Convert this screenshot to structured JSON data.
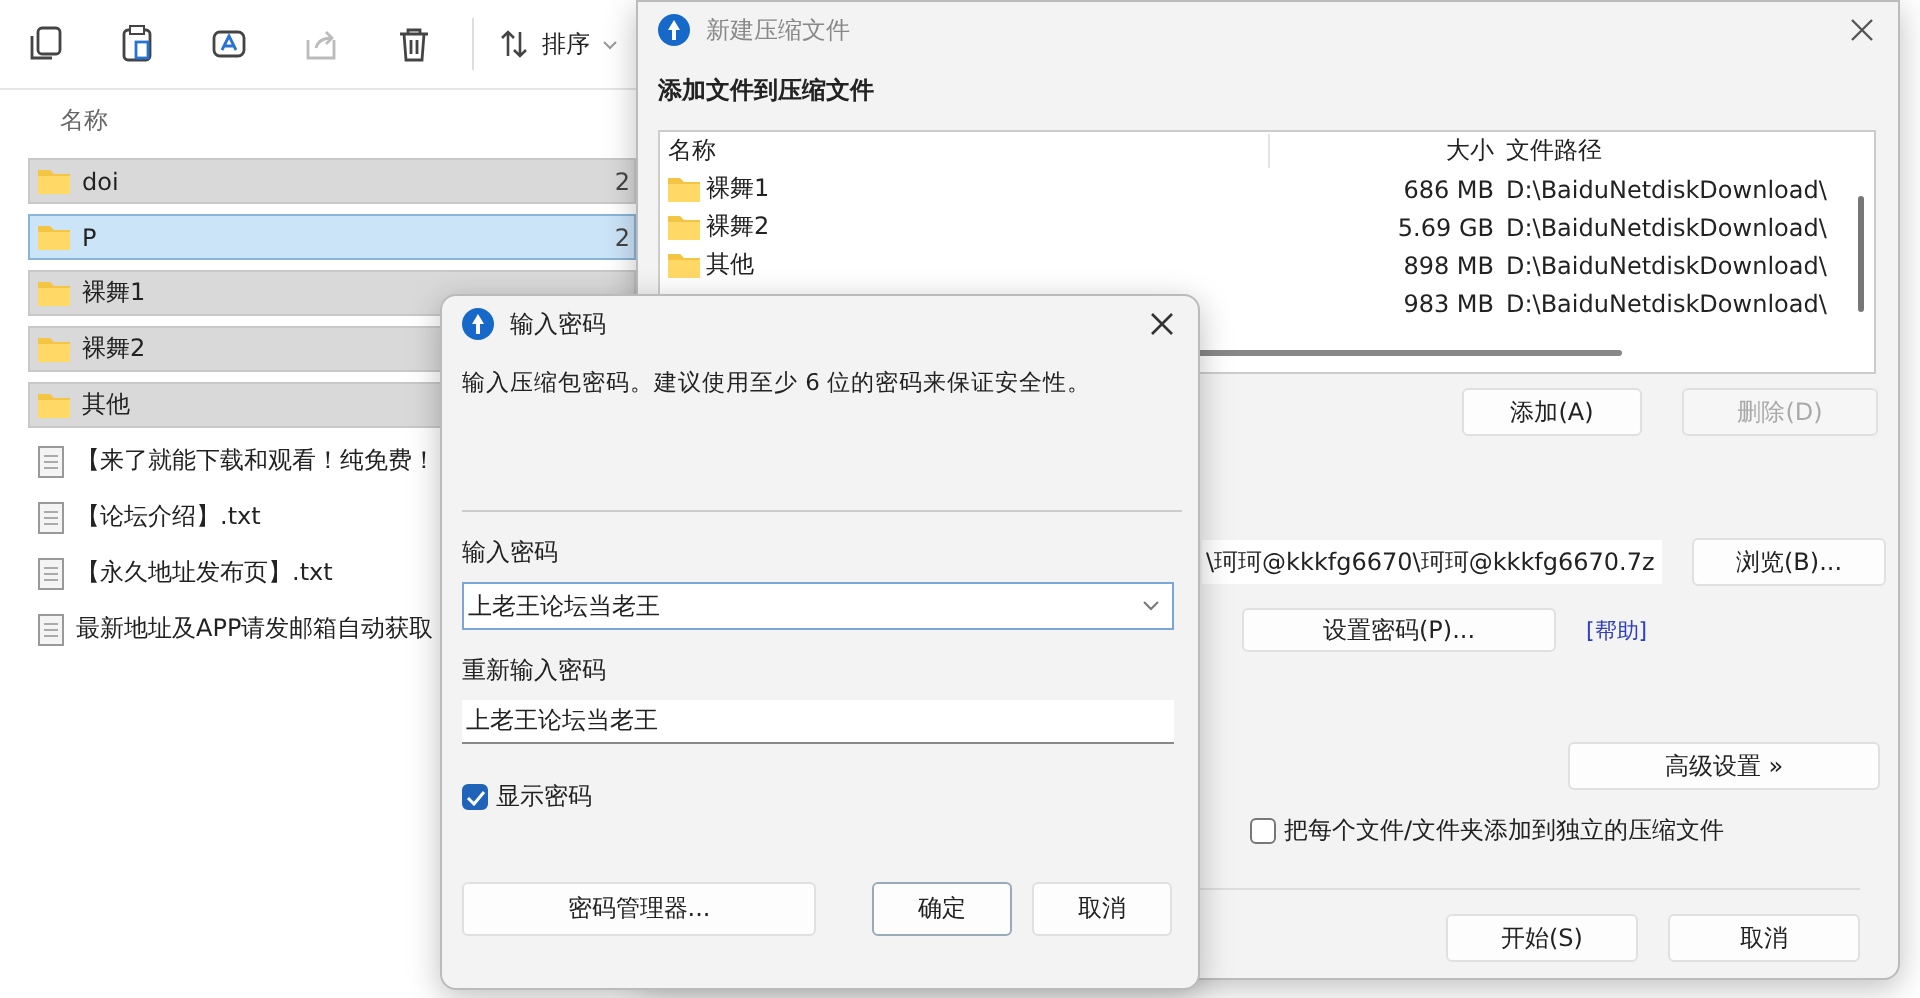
{
  "explorer": {
    "toolbar": [
      {
        "kind": "copy",
        "disabled": false
      },
      {
        "kind": "paste",
        "disabled": false
      },
      {
        "kind": "rename",
        "disabled": false
      },
      {
        "kind": "share",
        "disabled": true
      },
      {
        "kind": "delete",
        "disabled": false
      }
    ],
    "sort_button": {
      "label": "排序"
    },
    "columns": [
      {
        "label": "名称"
      }
    ],
    "items": [
      {
        "kind": "folder",
        "name": "doi",
        "column_2": "2",
        "selected": true,
        "focused": false
      },
      {
        "kind": "folder",
        "name": "P",
        "column_2": "2",
        "selected": true,
        "focused": true
      },
      {
        "kind": "folder",
        "name": "裸舞1",
        "selected": true,
        "focused": false
      },
      {
        "kind": "folder",
        "name": "裸舞2",
        "selected": true,
        "focused": false
      },
      {
        "kind": "folder",
        "name": "其他",
        "selected": true,
        "focused": false
      },
      {
        "kind": "file",
        "name": "【来了就能下载和观看！纯免费！",
        "selected": false,
        "focused": false
      },
      {
        "kind": "file",
        "name": "【论坛介绍】.txt",
        "selected": false,
        "focused": false
      },
      {
        "kind": "file",
        "name": "【永久地址发布页】.txt",
        "selected": false,
        "focused": false
      },
      {
        "kind": "file",
        "name": "最新地址及APP请发邮箱自动获取",
        "selected": false,
        "focused": false
      }
    ]
  },
  "archive_dialog": {
    "title": "新建压缩文件",
    "heading": "添加文件到压缩文件",
    "columns": [
      {
        "label": "名称"
      },
      {
        "label": "大小"
      },
      {
        "label": "文件路径"
      }
    ],
    "rows": [
      {
        "name": "裸舞1",
        "size": "686 MB",
        "path": "D:\\BaiduNetdiskDownload\\"
      },
      {
        "name": "裸舞2",
        "size": "5.69 GB",
        "path": "D:\\BaiduNetdiskDownload\\"
      },
      {
        "name": "其他",
        "size": "898 MB",
        "path": "D:\\BaiduNetdiskDownload\\"
      },
      {
        "size": "983 MB",
        "path": "D:\\BaiduNetdiskDownload\\"
      }
    ],
    "list_buttons": [
      {
        "label": "添加(A)",
        "disabled": false
      },
      {
        "label": "删除(D)",
        "disabled": true
      }
    ],
    "output_path": "\\珂珂@kkkfg6670\\珂珂@kkkfg6670.7z",
    "browse_button": "浏览(B)...",
    "password_button": "设置密码(P)...",
    "help_link": "[帮助]",
    "advanced_button": "高级设置 »",
    "separate_archives": {
      "label": "把每个文件/文件夹添加到独立的压缩文件",
      "checked": false
    },
    "footer_buttons": [
      {
        "label": "开始(S)"
      },
      {
        "label": "取消"
      }
    ]
  },
  "password_dialog": {
    "title": "输入密码",
    "message": "输入压缩包密码。建议使用至少 6 位的密码来保证安全性。",
    "password_label": "输入密码",
    "password": "上老王论坛当老王",
    "confirm_label": "重新输入密码",
    "confirm": "上老王论坛当老王",
    "show_password": {
      "label": "显示密码",
      "checked": true
    },
    "buttons": [
      {
        "label": "密码管理器...",
        "default": false
      },
      {
        "label": "确定",
        "default": true
      },
      {
        "label": "取消",
        "default": false
      }
    ]
  }
}
